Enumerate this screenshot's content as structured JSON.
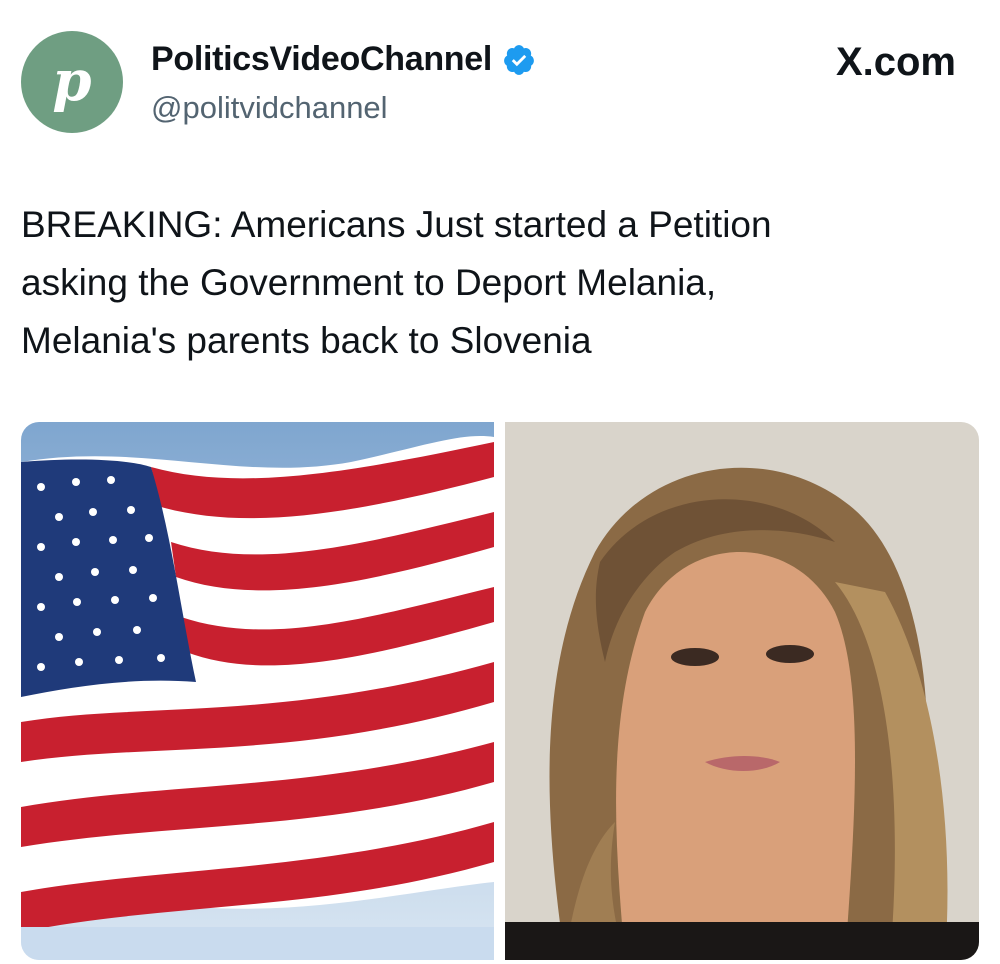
{
  "account": {
    "display_name": "PoliticsVideoChannel",
    "handle": "@politvidchannel",
    "avatar_letter": "p",
    "avatar_color": "#6f9e82",
    "verified": true
  },
  "site": {
    "label": "X.com"
  },
  "tweet": {
    "text": "BREAKING: Americans Just started a Petition\nasking the Government to Deport Melania,\nMelania's parents back to Slovenia"
  },
  "media": {
    "images": [
      {
        "icon": "us-flag-photo"
      },
      {
        "icon": "woman-portrait-photo"
      }
    ]
  },
  "colors": {
    "verified_badge": "#1d9bf0",
    "text": "#0f1419",
    "handle": "#536471"
  }
}
